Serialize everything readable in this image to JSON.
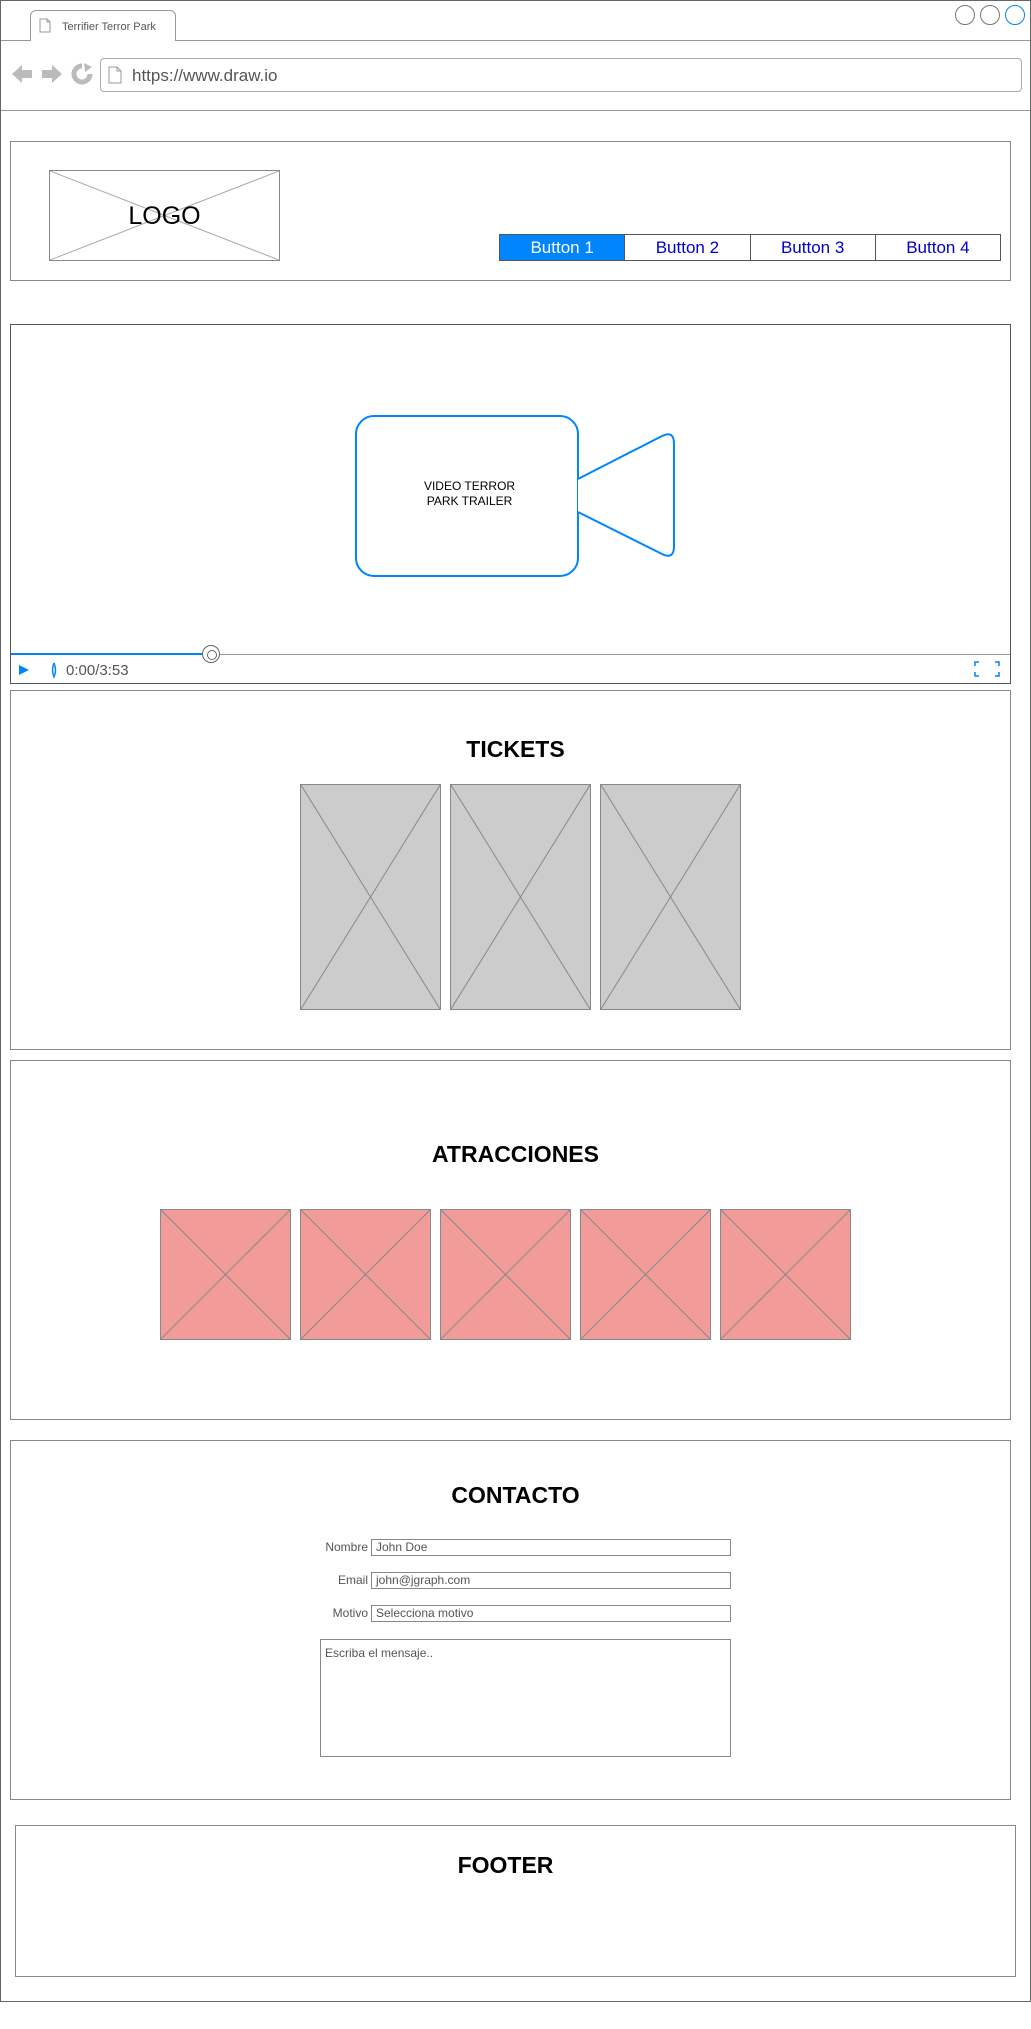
{
  "browser": {
    "tab_title": "Terrifier Terror Park",
    "url": "https://www.draw.io",
    "accent": "#0085fc"
  },
  "header": {
    "logo_label": "LOGO",
    "buttons": [
      "Button 1",
      "Button 2",
      "Button 3",
      "Button 4"
    ],
    "active_button_index": 0
  },
  "video": {
    "label_line1": "VIDEO TERROR",
    "label_line2": "PARK TRAILER",
    "time": "0:00/3:53",
    "progress_fraction": 0.2
  },
  "tickets": {
    "title": "TICKETS",
    "count": 3,
    "placeholder_color": "#cccccc"
  },
  "attractions": {
    "title": "ATRACCIONES",
    "count": 5,
    "placeholder_color": "#f19c99"
  },
  "contact": {
    "title": "CONTACTO",
    "fields": [
      {
        "label": "Nombre",
        "value": "John Doe"
      },
      {
        "label": "Email",
        "value": "john@jgraph.com"
      },
      {
        "label": "Motivo",
        "value": "Selecciona motivo"
      }
    ],
    "message_placeholder": "Escriba el mensaje.."
  },
  "footer": {
    "title": "FOOTER"
  }
}
